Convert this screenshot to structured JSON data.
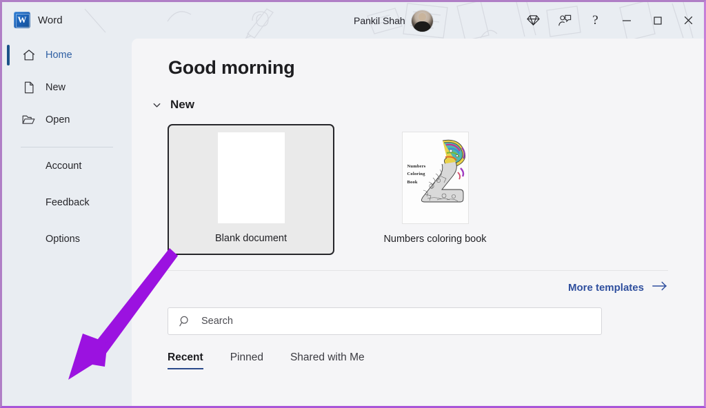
{
  "titlebar": {
    "app_name": "Word",
    "logo_letter": "W",
    "user_name": "Pankil Shah",
    "actions": [
      {
        "name": "diamond-icon",
        "label": "Microsoft 365 premium"
      },
      {
        "name": "feedback-person-icon",
        "label": "Feedback"
      },
      {
        "name": "help-icon",
        "label": "?"
      },
      {
        "name": "minimize-icon",
        "label": "Minimize"
      },
      {
        "name": "maximize-icon",
        "label": "Maximize"
      },
      {
        "name": "close-icon",
        "label": "Close"
      }
    ]
  },
  "sidebar": {
    "nav": [
      {
        "label": "Home",
        "icon": "home-icon",
        "active": true
      },
      {
        "label": "New",
        "icon": "new-document-icon",
        "active": false
      },
      {
        "label": "Open",
        "icon": "open-folder-icon",
        "active": false
      }
    ],
    "secondary": [
      {
        "label": "Account"
      },
      {
        "label": "Feedback"
      },
      {
        "label": "Options"
      }
    ]
  },
  "main": {
    "greeting": "Good morning",
    "new_section": {
      "title": "New",
      "collapse_icon": "chevron-down-icon",
      "templates": [
        {
          "label": "Blank document",
          "selected": true,
          "thumb_type": "blank"
        },
        {
          "label": "Numbers coloring book",
          "selected": false,
          "thumb_type": "coloring-book",
          "thumb_text": "Numbers\nColoring\nBook"
        }
      ]
    },
    "more_templates": {
      "label": "More templates",
      "icon": "arrow-right-icon"
    },
    "search": {
      "placeholder": "Search",
      "value": "",
      "icon": "search-icon"
    },
    "tabs": [
      {
        "label": "Recent",
        "active": true
      },
      {
        "label": "Pinned",
        "active": false
      },
      {
        "label": "Shared with Me",
        "active": false
      }
    ]
  },
  "annotation": {
    "arrow_color": "#9b12e0",
    "points_to": "Options"
  },
  "colors": {
    "accent_blue": "#1b5288",
    "link_blue": "#2f4f9e",
    "sidebar_bg": "#e9edf2",
    "main_bg": "#f5f5f7",
    "border_purple": "#b07ec6"
  }
}
